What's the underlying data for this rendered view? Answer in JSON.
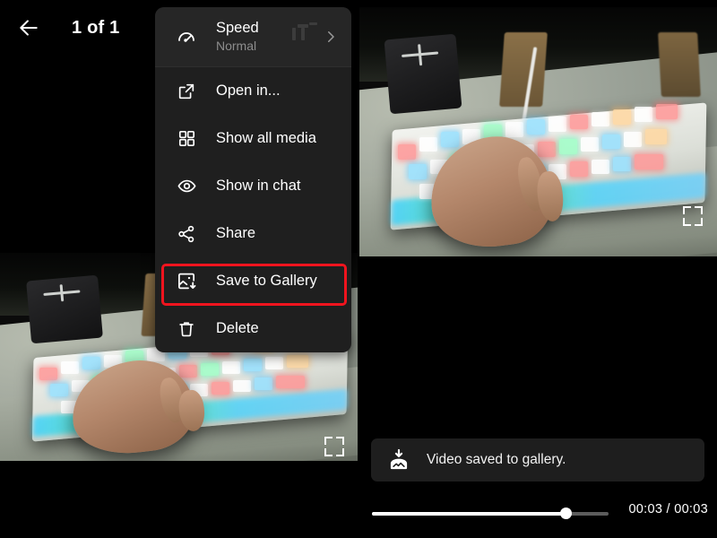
{
  "app": {
    "theme": "dark",
    "accent_red": "#f0141e",
    "menu_bg": "#1f1f1f",
    "menu_header_bg": "#262626",
    "toast_bg": "#1e1e1e"
  },
  "header": {
    "back_icon": "arrow-left-icon",
    "counter": "1 of 1"
  },
  "context_menu": {
    "speed": {
      "icon": "speedometer-icon",
      "title": "Speed",
      "value": "Normal",
      "chevron": "chevron-right-icon"
    },
    "items": [
      {
        "icon": "open-in-new-icon",
        "label": "Open in...",
        "highlighted": false
      },
      {
        "icon": "grid-icon",
        "label": "Show all media",
        "highlighted": false
      },
      {
        "icon": "eye-icon",
        "label": "Show in chat",
        "highlighted": false
      },
      {
        "icon": "share-icon",
        "label": "Share",
        "highlighted": false
      },
      {
        "icon": "save-image-icon",
        "label": "Save to Gallery",
        "highlighted": true
      },
      {
        "icon": "trash-icon",
        "label": "Delete",
        "highlighted": false
      }
    ]
  },
  "highlight": {
    "target_label": "Save to Gallery",
    "color": "#f0141e"
  },
  "toast": {
    "icon": "download-to-gallery-icon",
    "message": "Video saved to gallery."
  },
  "player": {
    "current_time": "00:03",
    "duration": "00:03",
    "time_display": "00:03 / 00:03",
    "progress_percent": 82,
    "fullscreen_icon": "fullscreen-icon"
  },
  "media": {
    "left_panel_caption": "video of hands typing on an RGB backlit mechanical keyboard",
    "right_panel_caption": "video of hands typing on an RGB backlit mechanical keyboard"
  }
}
